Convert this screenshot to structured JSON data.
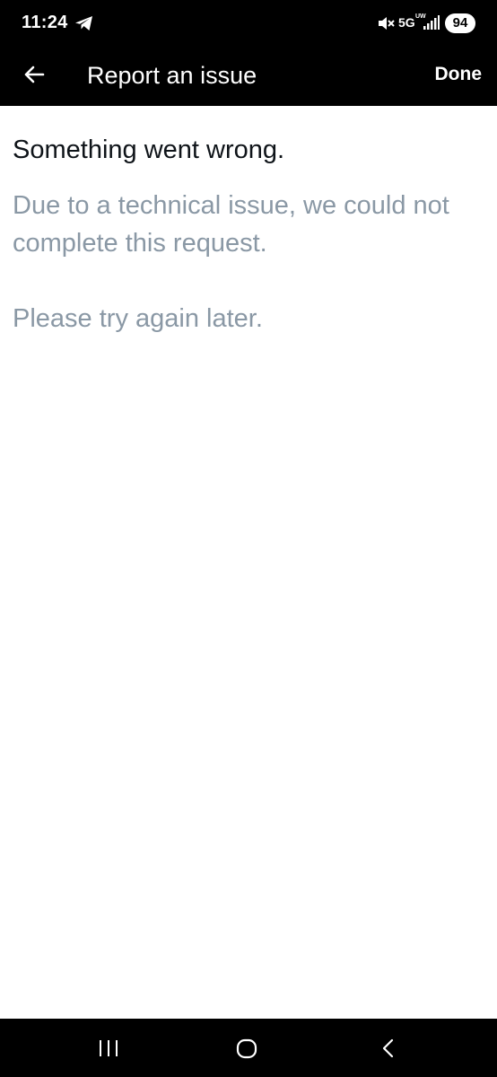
{
  "status_bar": {
    "time": "11:24",
    "network": "5G",
    "network_sub": "UW",
    "battery": "94",
    "icons": [
      "telegram-icon",
      "mute-icon",
      "signal-icon"
    ]
  },
  "app_bar": {
    "title": "Report an issue",
    "done_label": "Done",
    "back_icon": "arrow-left-icon"
  },
  "content": {
    "heading": "Something went wrong.",
    "detail": "Due to a technical issue, we could not complete this request.",
    "retry": "Please try again later."
  },
  "nav_bar": {
    "icons": [
      "recents-icon",
      "home-icon",
      "back-icon"
    ]
  },
  "colors": {
    "bar_background": "#000000",
    "page_background": "#ffffff",
    "heading_text": "#0f1419",
    "secondary_text": "#8a98a5"
  }
}
